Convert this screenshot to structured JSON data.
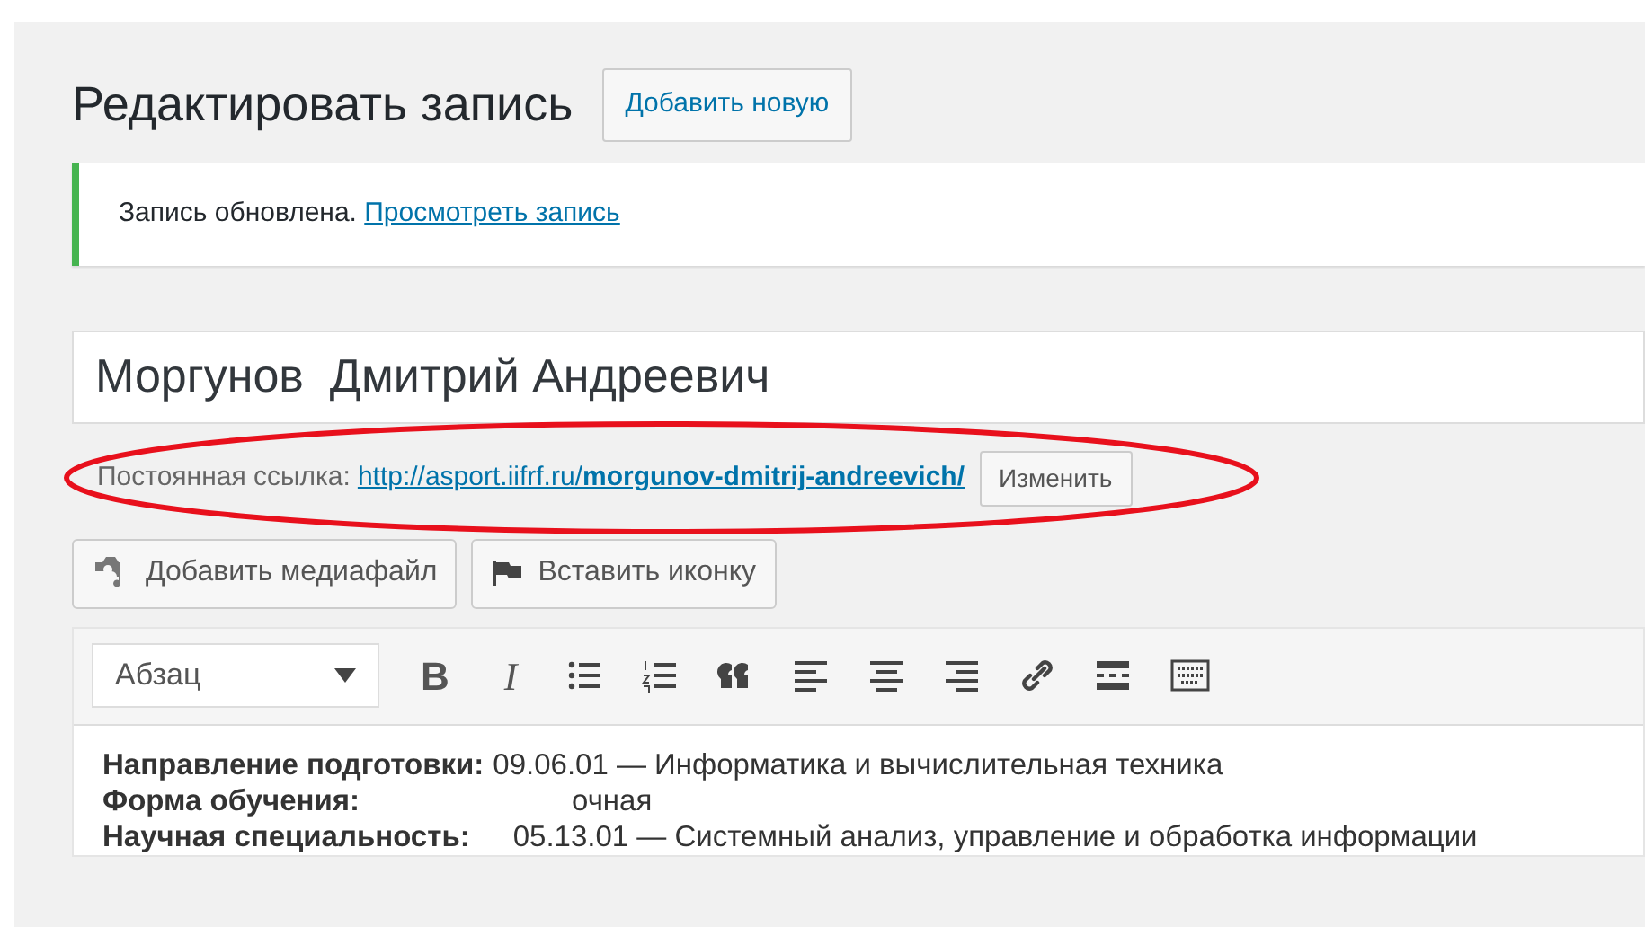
{
  "heading": {
    "title": "Редактировать запись",
    "add_button": "Добавить новую"
  },
  "notice": {
    "text": "Запись обновлена.",
    "link": "Просмотреть запись"
  },
  "post_title": {
    "value": "Моргунов  Дмитрий Андреевич"
  },
  "permalink": {
    "label": "Постоянная ссылка:",
    "url_base": "http://asport.iifrf.ru/",
    "slug": "morgunov-dmitrij-andreevich/",
    "edit_button": "Изменить",
    "highlighted": true
  },
  "media_buttons": [
    {
      "kind": "media",
      "label": "Добавить медиафайл"
    },
    {
      "kind": "flag",
      "label": "Вставить иконку"
    }
  ],
  "toolbar": {
    "format": "Абзац",
    "buttons": [
      {
        "kind": "bold",
        "label": "B"
      },
      {
        "kind": "italic",
        "label": "I"
      },
      {
        "kind": "bullets"
      },
      {
        "kind": "numbers"
      },
      {
        "kind": "quote"
      },
      {
        "kind": "align-left"
      },
      {
        "kind": "align-center"
      },
      {
        "kind": "align-right"
      },
      {
        "kind": "link"
      },
      {
        "kind": "more"
      },
      {
        "kind": "keyboard"
      }
    ]
  },
  "content": [
    {
      "label": "Направление подготовки:",
      "value": "09.06.01 — Информатика и вычислительная техника"
    },
    {
      "label": "Форма обучения:",
      "value": "очная"
    },
    {
      "label": "Научная специальность:",
      "value": "05.13.01 — Системный анализ, управление и обработка информации"
    }
  ]
}
